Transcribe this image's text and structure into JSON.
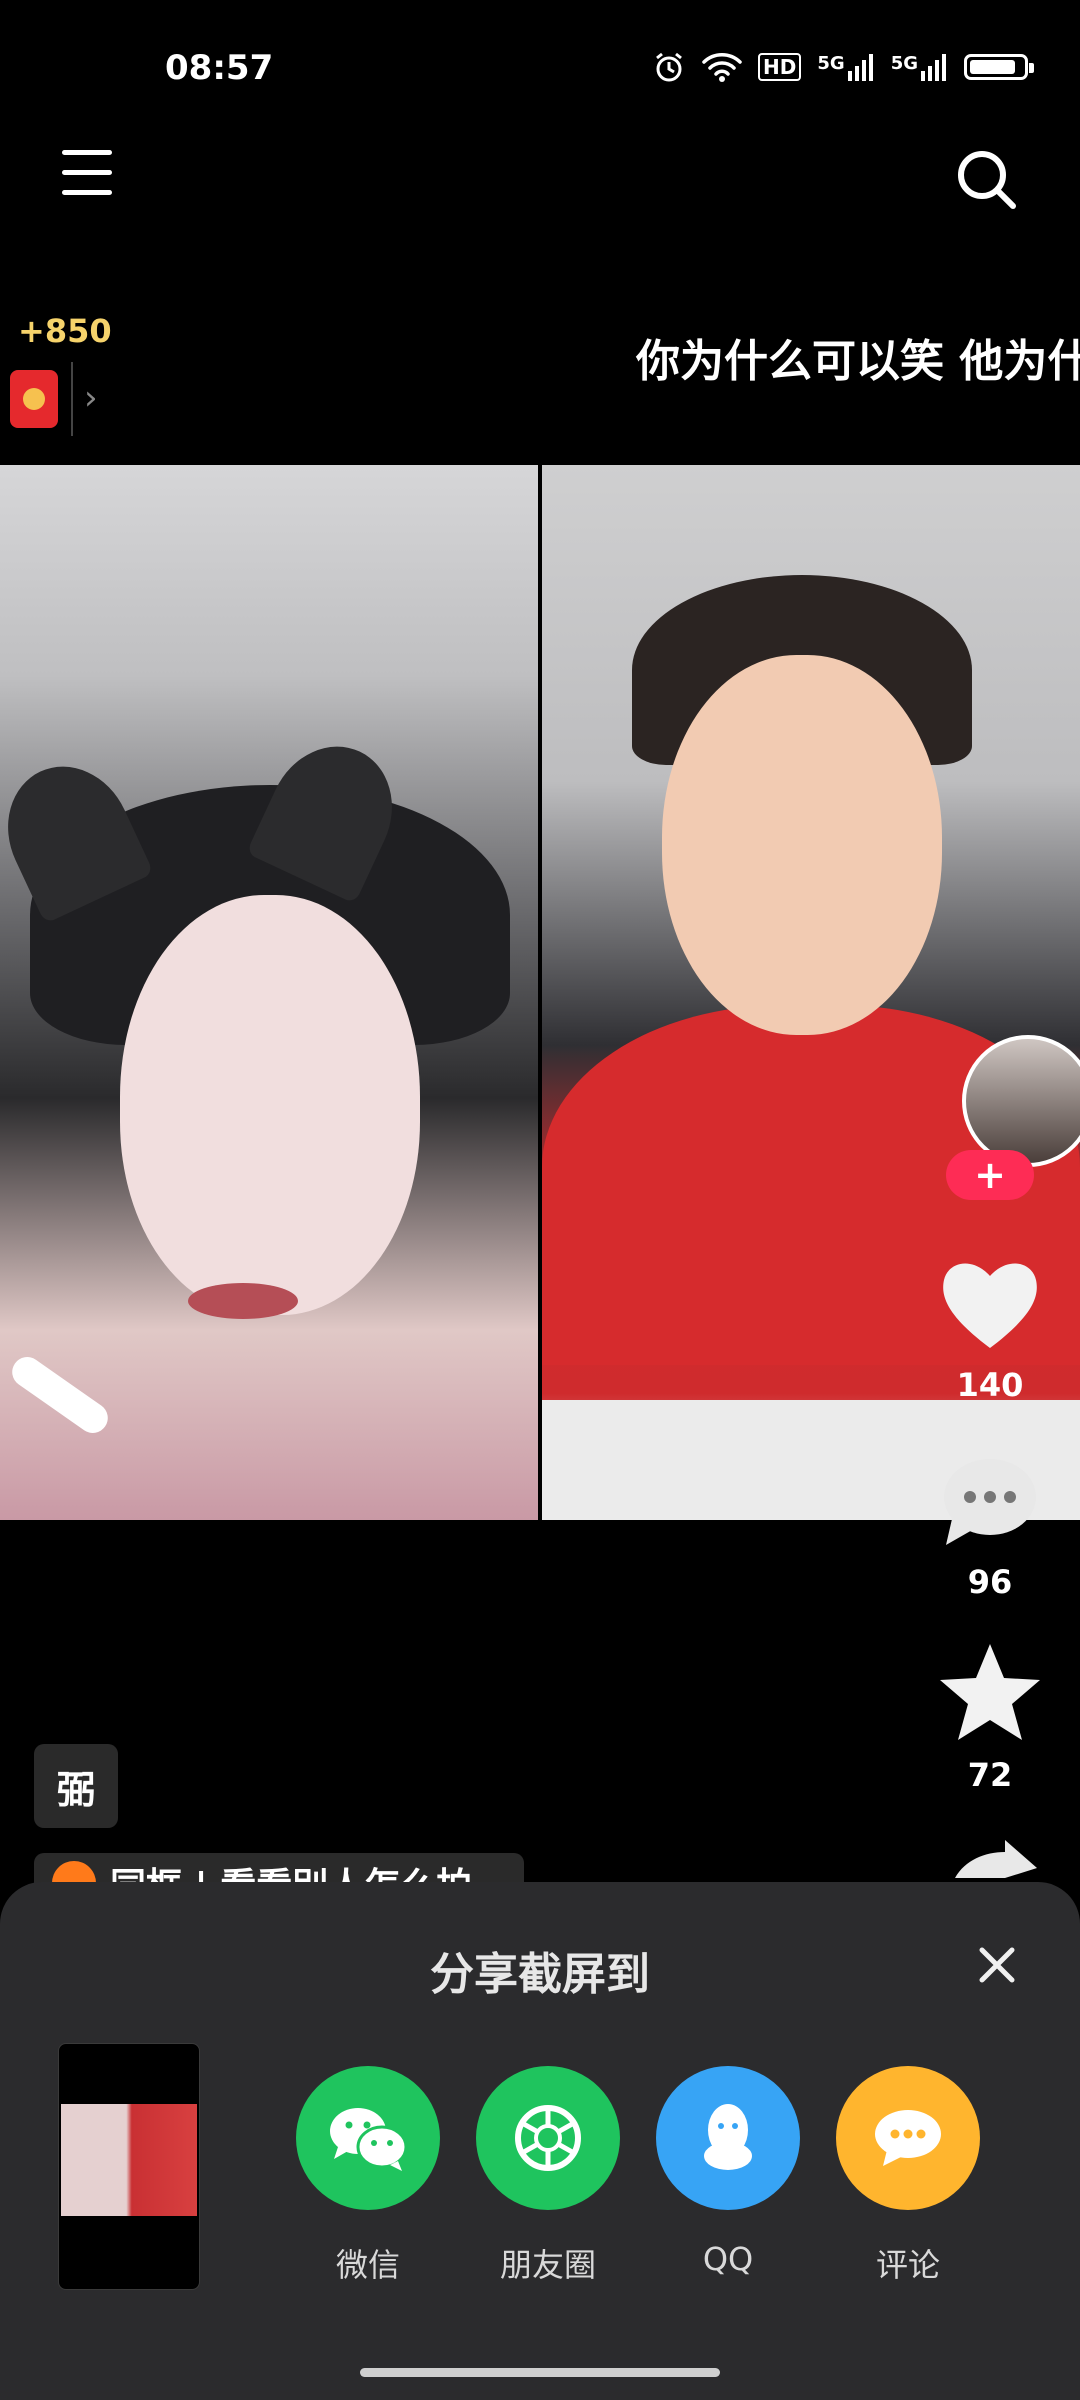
{
  "status_bar": {
    "time": "08:57",
    "hd_label": "HD",
    "signal1": "5G",
    "signal2": "5G"
  },
  "top": {
    "coin_count": "+850",
    "caption": "你为什么可以笑 他为什"
  },
  "rail": {
    "likes": "140",
    "comments": "96",
    "favorites": "72",
    "follow_symbol": "+"
  },
  "tag_chip": "弼",
  "music_chip": "同框 | 看看别人怎么拍",
  "share_sheet": {
    "title": "分享截屏到",
    "options": [
      {
        "label": "微信",
        "icon": "wechat-icon",
        "color": "#1fc45e"
      },
      {
        "label": "朋友圈",
        "icon": "moments-icon",
        "color": "#1fc45e"
      },
      {
        "label": "QQ",
        "icon": "qq-icon",
        "color": "#37a4f5"
      },
      {
        "label": "评论",
        "icon": "comment-bubble-icon",
        "color": "#ffb52e"
      }
    ]
  },
  "colors": {
    "accent": "#fe2c55",
    "coin": "#f6d36b",
    "sheet_bg": "#2b2b2d"
  }
}
